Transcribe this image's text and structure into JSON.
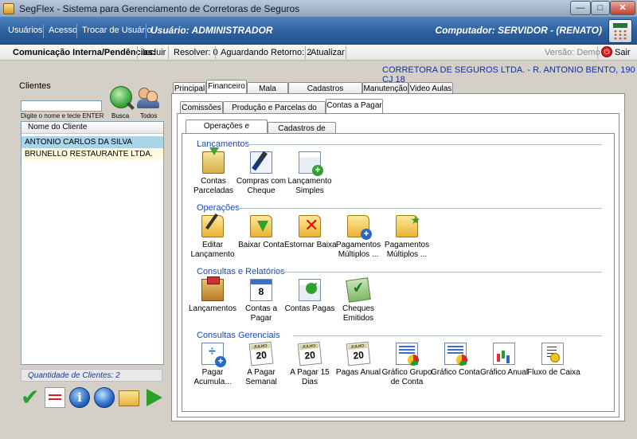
{
  "window": {
    "title": "SegFlex - Sistema para Gerenciamento de Corretoras de Seguros",
    "min_label": "—",
    "max_label": "□",
    "close_label": "✕"
  },
  "menu": {
    "items": [
      "Usuários",
      "Acesso",
      "Trocar de Usuário"
    ],
    "user": "Usuário: ADMINISTRADOR",
    "computer": "Computador: SERVIDOR - (RENATO)"
  },
  "toolbar": {
    "label": "Comunicação Interna/Pendências:",
    "incluir": "Incluir",
    "resolver": "Resolver: 0",
    "aguardando": "Aguardando Retorno: 2",
    "atualizar": "Atualizar",
    "version": "Versão: Demo",
    "sair": "Sair"
  },
  "corretora": "CORRETORA DE SEGUROS LTDA. - R. ANTONIO BENTO, 190 CJ 18",
  "clients": {
    "group_label": "Clientes",
    "search_placeholder": "",
    "search_hint": "Digite o nome e tecle ENTER",
    "busca_label": "Busca",
    "todos_label": "Todos",
    "column": "Nome do Cliente",
    "rows": [
      "ANTONIO CARLOS DA SILVA",
      "BRUNELLO RESTAURANTE LTDA."
    ],
    "quantity": "Quantidade de Clientes: 2"
  },
  "main_tabs": [
    "Principal",
    "Financeiro",
    "Mala Direta",
    "Cadastros Auxiliares",
    "Manutenção",
    "Video Aulas"
  ],
  "sub_tabs": [
    "Comissões",
    "Produção e Parcelas do Cliente",
    "Contas a Pagar"
  ],
  "inner_tabs": [
    "Operações e Consultas",
    "Cadastros de Apoio"
  ],
  "sections": {
    "lancamentos": {
      "title": "Lançamentos",
      "items": [
        {
          "l1": "Contas",
          "l2": "Parceladas",
          "icon": "drawer-icon"
        },
        {
          "l1": "Compras com",
          "l2": "Cheque",
          "icon": "pen-icon"
        },
        {
          "l1": "Lançamento",
          "l2": "Simples",
          "icon": "window-add-icon"
        }
      ]
    },
    "operacoes": {
      "title": "Operações",
      "items": [
        {
          "l1": "Editar",
          "l2": "Lançamento"
        },
        {
          "l1": "Baixar Conta",
          "l2": ""
        },
        {
          "l1": "Estornar Baixa",
          "l2": ""
        },
        {
          "l1": "Pagamentos",
          "l2": "Múltiplos ..."
        },
        {
          "l1": "Pagamentos",
          "l2": "Múltiplos ..."
        }
      ]
    },
    "consultas": {
      "title": "Consultas e Relatórios",
      "items": [
        {
          "l1": "Lançamentos",
          "l2": ""
        },
        {
          "l1": "Contas a",
          "l2": "Pagar",
          "cal": "8"
        },
        {
          "l1": "Contas Pagas",
          "l2": ""
        },
        {
          "l1": "Cheques",
          "l2": "Emitidos"
        }
      ]
    },
    "gerenciais": {
      "title": "Consultas Gerenciais",
      "items": [
        {
          "l1": "Pagar",
          "l2": "Acumula..."
        },
        {
          "l1": "A Pagar",
          "l2": "Semanal",
          "m": "JULHO",
          "d": "20"
        },
        {
          "l1": "A Pagar 15",
          "l2": "Dias",
          "m": "JULHO",
          "d": "20"
        },
        {
          "l1": "Pagas Anual",
          "l2": "",
          "m": "JULHO",
          "d": "20"
        },
        {
          "l1": "Gráfico Grupo",
          "l2": "de Conta"
        },
        {
          "l1": "Gráfico Conta",
          "l2": ""
        },
        {
          "l1": "Gráfico Anual",
          "l2": ""
        },
        {
          "l1": "Fluxo de Caixa",
          "l2": ""
        }
      ]
    }
  }
}
